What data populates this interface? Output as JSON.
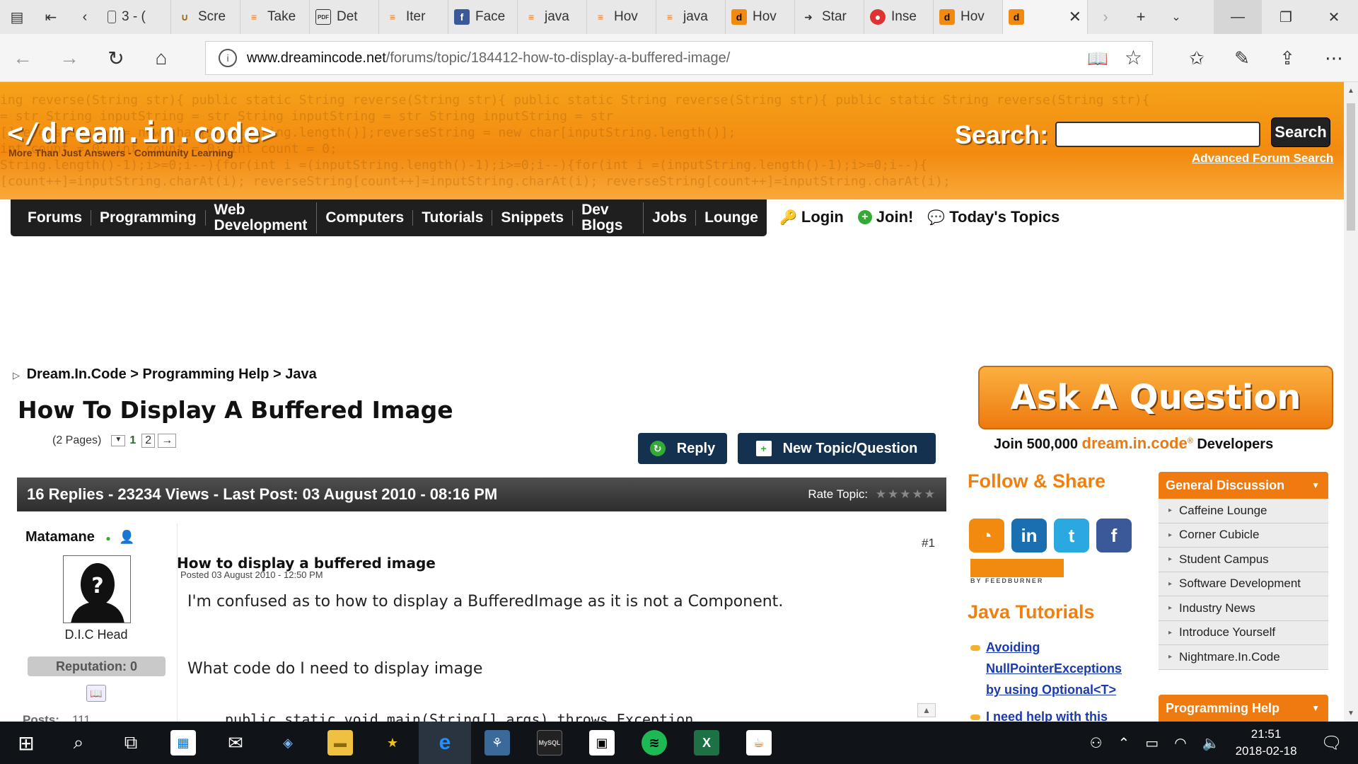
{
  "browser": {
    "tabs": [
      {
        "label": "3 - (",
        "fav": "page-icon"
      },
      {
        "label": "Scre",
        "fav": "horseshoe-icon"
      },
      {
        "label": "Take",
        "fav": "stackoverflow-icon"
      },
      {
        "label": "Det",
        "fav": "pdf-icon"
      },
      {
        "label": "Iter",
        "fav": "stackoverflow-icon"
      },
      {
        "label": "Face",
        "fav": "facebook-icon"
      },
      {
        "label": "java",
        "fav": "stackoverflow-icon"
      },
      {
        "label": "Hov",
        "fav": "stackoverflow-icon"
      },
      {
        "label": "java",
        "fav": "stackoverflow-icon"
      },
      {
        "label": "Hov",
        "fav": "dreamincode-icon"
      },
      {
        "label": "Star",
        "fav": "arrow-icon"
      },
      {
        "label": "Inse",
        "fav": "chrome-icon"
      },
      {
        "label": "Hov",
        "fav": "dreamincode-icon"
      }
    ],
    "url_host": "www.dreamincode.net",
    "url_path": "/forums/topic/184412-how-to-display-a-buffered-image/"
  },
  "site": {
    "logo": "</dream.in.code>",
    "tagline": "More Than Just Answers - Community Learning",
    "search_label": "Search:",
    "search_button": "Search",
    "advanced_search": "Advanced Forum Search",
    "code_bg": [
      "ing reverse(String str){        public static String reverse(String str){        public static String reverse(String str){        public static String reverse(String str){",
      " = str               String inputString = str               String inputString = str               String inputString = str",
      "                     []reverseString = new char[inputString.length()];reverseString = new char[inputString.length()];",
      "                     int count = 0;               int count = 0;               int count = 0;",
      "String.length()-1);i>=0;i--){for(int i =(inputString.length()-1);i>=0;i--){for(int i =(inputString.length()-1);i>=0;i--){",
      "[count++]=inputString.charAt(i);  reverseString[count++]=inputString.charAt(i);  reverseString[count++]=inputString.charAt(i);"
    ]
  },
  "nav": {
    "items": [
      "Forums",
      "Programming",
      "Web Development",
      "Computers",
      "Tutorials",
      "Snippets",
      "Dev Blogs",
      "Jobs",
      "Lounge"
    ],
    "login": "Login",
    "join": "Join!",
    "todays_topics": "Today's Topics"
  },
  "breadcrumb": {
    "items": [
      "Dream.In.Code",
      ">",
      "Programming Help",
      ">",
      "Java"
    ]
  },
  "topic": {
    "title": "How To Display A Buffered Image",
    "pages_text": "(2 Pages)",
    "page_current": "1",
    "page_next": "2",
    "page_arrow": "→",
    "reply_button": "Reply",
    "new_topic_button": "New Topic/Question",
    "stats": "16 Replies - 23234 Views - Last Post: 03 August 2010 - 08:16 PM",
    "rate_label": "Rate Topic:",
    "rate_stars": "★★★★★"
  },
  "post": {
    "author": "Matamane",
    "rank": "D.I.C Head",
    "reputation": "Reputation: 0",
    "posts_label": "Posts:",
    "posts_count": "111",
    "number": "#1",
    "title": "How to display a buffered image",
    "date": "Posted 03 August 2010 - 12:50 PM",
    "body1": "I'm confused as to how to display a BufferedImage as it is not a Component.",
    "body2": "What code do I need to display image",
    "code": "public static void main(String[] args) throws Exception"
  },
  "sidebar": {
    "ask_button": "Ask A Question",
    "join_prefix": "Join 500,000",
    "join_brand": "dream.in.code",
    "join_reg": "®",
    "join_suffix": "Developers",
    "follow_title": "Follow & Share",
    "socials": [
      "rss-icon",
      "linkedin-icon",
      "twitter-icon",
      "facebook-icon"
    ],
    "feedburner": "BY FEEDBURNER",
    "java_tutorials_title": "Java Tutorials",
    "tutorials": [
      "Avoiding NullPointerExceptions by using Optional<T>",
      "I need help with this Array"
    ],
    "general_discussion": {
      "title": "General Discussion",
      "items": [
        "Caffeine Lounge",
        "Corner Cubicle",
        "Student Campus",
        "Software Development",
        "Industry News",
        "Introduce Yourself",
        "Nightmare.In.Code"
      ]
    },
    "programming_help": "Programming Help"
  },
  "taskbar": {
    "time": "21:51",
    "date": "2018-02-18"
  },
  "colors": {
    "header_orange": "#f28a10",
    "nav_dark": "#1f1f1f",
    "button_navy": "#14314f",
    "accent_orange": "#ef8010",
    "link_blue": "#1a3ab0"
  }
}
